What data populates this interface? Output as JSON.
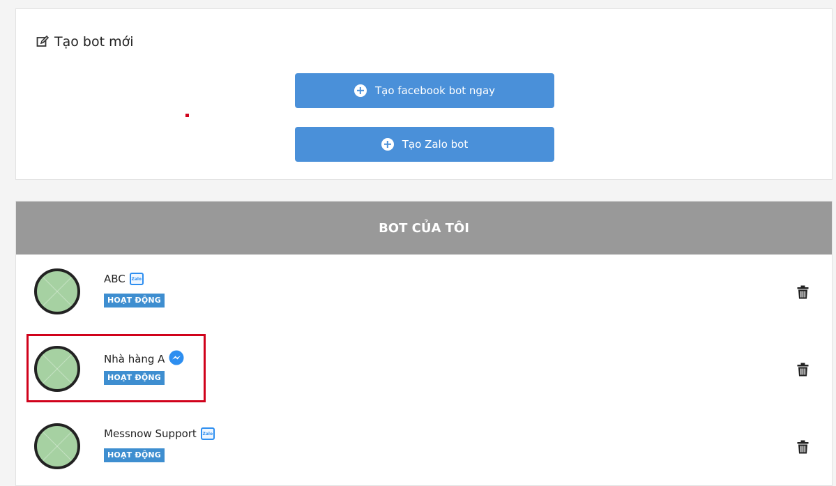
{
  "create_section": {
    "title": "Tạo bot mới",
    "facebook_button": "Tạo facebook bot ngay",
    "zalo_button": "Tạo Zalo bot"
  },
  "my_bots": {
    "header": "BOT CỦA TÔI",
    "bots": [
      {
        "name": "ABC",
        "platform": "zalo",
        "platform_icon": "zalo-icon",
        "platform_label": "Zalo",
        "status": "HOẠT ĐỘNG"
      },
      {
        "name": "Nhà hàng A",
        "platform": "messenger",
        "platform_icon": "messenger-icon",
        "status": "HOẠT ĐỘNG"
      },
      {
        "name": "Messnow Support",
        "platform": "zalo",
        "platform_icon": "zalo-icon",
        "platform_label": "Zalo",
        "status": "HOẠT ĐỘNG"
      }
    ]
  },
  "colors": {
    "primary_button": "#4a90d9",
    "header_bg": "#999999",
    "status_badge": "#3e8ed0",
    "highlight": "#d0021b"
  }
}
